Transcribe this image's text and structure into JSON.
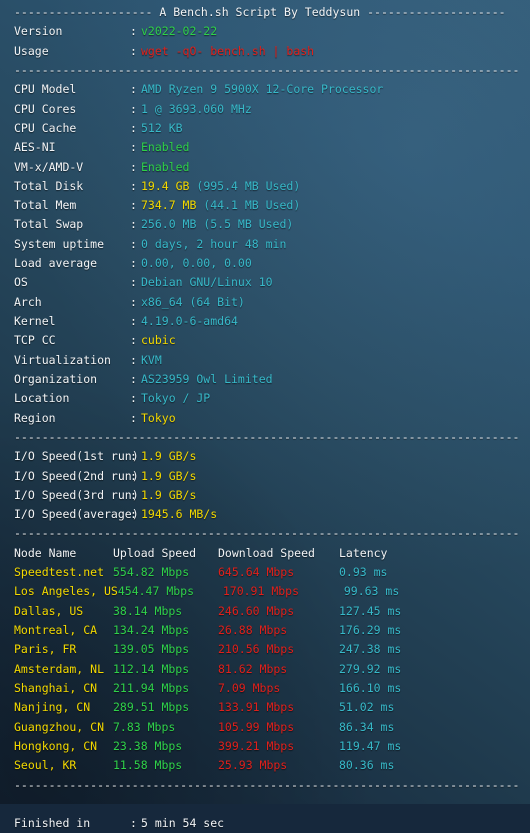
{
  "terminal": {
    "title_line": "-------------------- A Bench.sh Script By Teddysun --------------------",
    "rule": "-------------------------------------------------------------------------",
    "finished_label": "Finished in",
    "finished_value": "5 min 54 sec",
    "colon": ":"
  },
  "header": {
    "rows": [
      {
        "label": "Version",
        "value": "v2022-02-22",
        "color": "green"
      },
      {
        "label": "Usage",
        "value": "wget -qO- bench.sh | bash",
        "color": "red"
      }
    ]
  },
  "sysinfo": {
    "rows": [
      {
        "label": "CPU Model",
        "value": "AMD Ryzen 9 5900X 12-Core Processor",
        "color": "cyan"
      },
      {
        "label": "CPU Cores",
        "value": "1 @ 3693.060 MHz",
        "color": "cyan"
      },
      {
        "label": "CPU Cache",
        "value": "512 KB",
        "color": "cyan"
      },
      {
        "label": "AES-NI",
        "value": "Enabled",
        "color": "green"
      },
      {
        "label": "VM-x/AMD-V",
        "value": "Enabled",
        "color": "green"
      },
      {
        "label": "Total Disk",
        "value": "19.4 GB",
        "color": "yellow",
        "extra": " (995.4 MB Used)",
        "extra_color": "cyan"
      },
      {
        "label": "Total Mem",
        "value": "734.7 MB",
        "color": "yellow",
        "extra": " (44.1 MB Used)",
        "extra_color": "cyan"
      },
      {
        "label": "Total Swap",
        "value": "256.0 MB",
        "color": "cyan",
        "extra": " (5.5 MB Used)",
        "extra_color": "cyan"
      },
      {
        "label": "System uptime",
        "value": "0 days, 2 hour 48 min",
        "color": "cyan"
      },
      {
        "label": "Load average",
        "value": "0.00, 0.00, 0.00",
        "color": "cyan"
      },
      {
        "label": "OS",
        "value": "Debian GNU/Linux 10",
        "color": "cyan"
      },
      {
        "label": "Arch",
        "value": "x86_64 (64 Bit)",
        "color": "cyan"
      },
      {
        "label": "Kernel",
        "value": "4.19.0-6-amd64",
        "color": "cyan"
      },
      {
        "label": "TCP CC",
        "value": "cubic",
        "color": "yellow"
      },
      {
        "label": "Virtualization",
        "value": "KVM",
        "color": "cyan"
      },
      {
        "label": "Organization",
        "value": "AS23959 Owl Limited",
        "color": "cyan"
      },
      {
        "label": "Location",
        "value": "Tokyo / JP",
        "color": "cyan"
      },
      {
        "label": "Region",
        "value": "Tokyo",
        "color": "yellow"
      }
    ]
  },
  "iospeed": {
    "rows": [
      {
        "label": "I/O Speed(1st run)",
        "value": "1.9 GB/s",
        "color": "yellow"
      },
      {
        "label": "I/O Speed(2nd run)",
        "value": "1.9 GB/s",
        "color": "yellow"
      },
      {
        "label": "I/O Speed(3rd run)",
        "value": "1.9 GB/s",
        "color": "yellow"
      },
      {
        "label": "I/O Speed(average)",
        "value": "1945.6 MB/s",
        "color": "yellow"
      }
    ]
  },
  "speedtest": {
    "columns": [
      "Node Name",
      "Upload Speed",
      "Download Speed",
      "Latency"
    ],
    "rows": [
      {
        "node": "Speedtest.net",
        "upload": "554.82 Mbps",
        "download": "645.64 Mbps",
        "latency": "0.93 ms"
      },
      {
        "node": "Los Angeles, US",
        "upload": "454.47 Mbps",
        "download": "170.91 Mbps",
        "latency": "99.63 ms"
      },
      {
        "node": "Dallas, US",
        "upload": "38.14 Mbps",
        "download": "246.60 Mbps",
        "latency": "127.45 ms"
      },
      {
        "node": "Montreal, CA",
        "upload": "134.24 Mbps",
        "download": "26.88 Mbps",
        "latency": "176.29 ms"
      },
      {
        "node": "Paris, FR",
        "upload": "139.05 Mbps",
        "download": "210.56 Mbps",
        "latency": "247.38 ms"
      },
      {
        "node": "Amsterdam, NL",
        "upload": "112.14 Mbps",
        "download": "81.62 Mbps",
        "latency": "279.92 ms"
      },
      {
        "node": "Shanghai, CN",
        "upload": "211.94 Mbps",
        "download": "7.09 Mbps",
        "latency": "166.10 ms"
      },
      {
        "node": "Nanjing, CN",
        "upload": "289.51 Mbps",
        "download": "133.91 Mbps",
        "latency": "51.02 ms"
      },
      {
        "node": "Guangzhou, CN",
        "upload": "7.83 Mbps",
        "download": "105.99 Mbps",
        "latency": "86.34 ms"
      },
      {
        "node": "Hongkong, CN",
        "upload": "23.38 Mbps",
        "download": "399.21 Mbps",
        "latency": "119.47 ms"
      },
      {
        "node": "Seoul, KR",
        "upload": "11.58 Mbps",
        "download": "25.93 Mbps",
        "latency": "80.36 ms"
      }
    ]
  },
  "colors": {
    "green": "#2fd14a",
    "red": "#e0201b",
    "cyan": "#37b9c9",
    "yellow": "#f3d900",
    "white": "#f2f4f6",
    "background_top_right": "#315a76",
    "background_bottom_left": "#152639"
  }
}
